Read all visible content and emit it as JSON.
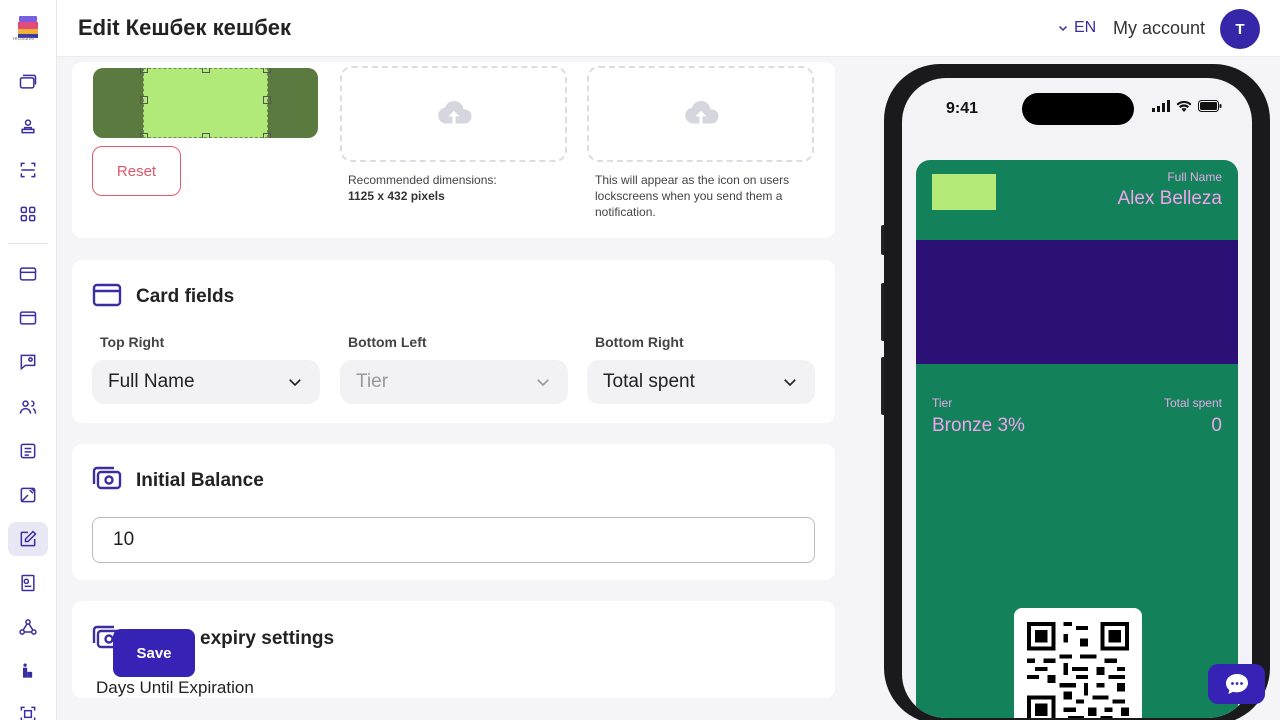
{
  "header": {
    "title": "Edit Кешбек кешбек",
    "language": "EN",
    "account": "My account",
    "avatar_initial": "T"
  },
  "sidebar": {
    "logo_text": "recordme",
    "items": [
      "cards-icon",
      "users-icon",
      "scan-icon",
      "apps-icon",
      "card-icon",
      "wallet-icon",
      "chat-icon",
      "customers-icon",
      "news-icon",
      "map-icon",
      "edit-icon",
      "report-icon",
      "network-icon",
      "stats-icon",
      "qr-icon"
    ]
  },
  "images": {
    "reset_label": "Reset",
    "strip_hint_line1": "Recommended dimensions:",
    "strip_hint_line2": "1125 x 432 pixels",
    "icon_hint": "This will appear as the icon on users lockscreens when you send them a notification."
  },
  "card_fields": {
    "title": "Card fields",
    "top_right_label": "Top Right",
    "top_right_value": "Full Name",
    "bottom_left_label": "Bottom Left",
    "bottom_left_value": "Tier",
    "bottom_right_label": "Bottom Right",
    "bottom_right_value": "Total spent"
  },
  "initial_balance": {
    "title": "Initial Balance",
    "value": "10"
  },
  "expiry": {
    "title": "expiry settings",
    "days_label": "Days Until Expiration"
  },
  "save_label": "Save",
  "phone": {
    "time": "9:41",
    "pass": {
      "header_label": "Full Name",
      "header_value": "Alex Belleza",
      "left_label": "Tier",
      "left_value": "Bronze 3%",
      "right_label": "Total spent",
      "right_value": "0"
    }
  },
  "colors": {
    "brand": "#3722b6",
    "pass_bg": "#13825a",
    "strip_bg": "#2b1075",
    "logo_color": "#b3ea78"
  }
}
